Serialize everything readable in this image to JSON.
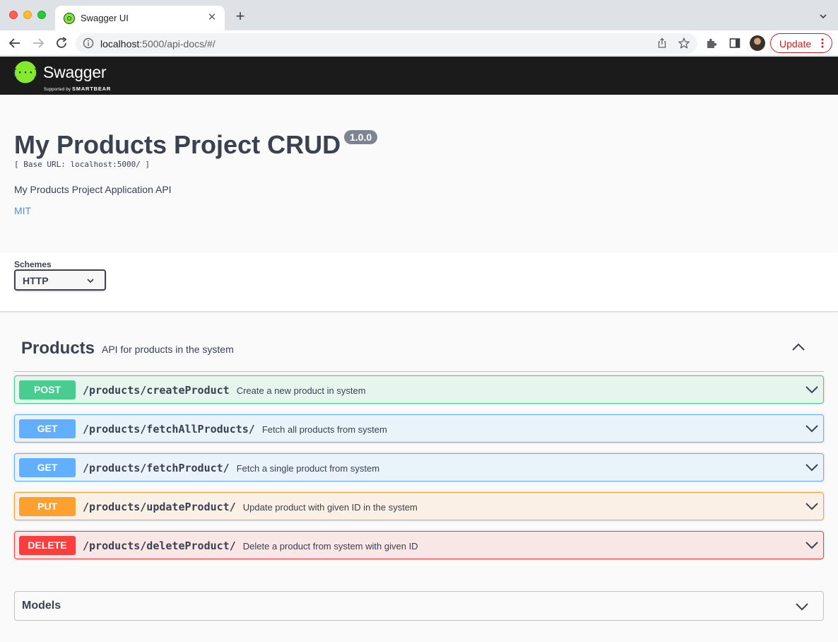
{
  "browser": {
    "tab_title": "Swagger UI",
    "url_host": "localhost",
    "url_path": ":5000/api-docs/#/",
    "update_label": "Update"
  },
  "swagger": {
    "logo_text": "Swagger",
    "logo_sub_prefix": "Supported by",
    "logo_sub_brand": "SMARTBEAR"
  },
  "info": {
    "title": "My Products Project CRUD",
    "version": "1.0.0",
    "base_url": "[ Base URL: localhost:5000/ ]",
    "description": "My Products Project Application API",
    "license": "MIT"
  },
  "schemes": {
    "label": "Schemes",
    "selected": "HTTP"
  },
  "tag": {
    "name": "Products",
    "description": "API for products in the system"
  },
  "operations": [
    {
      "method": "POST",
      "path": "/products/createProduct",
      "summary": "Create a new product in system"
    },
    {
      "method": "GET",
      "path": "/products/fetchAllProducts/",
      "summary": "Fetch all products from system"
    },
    {
      "method": "GET",
      "path": "/products/fetchProduct/",
      "summary": "Fetch a single product from system"
    },
    {
      "method": "PUT",
      "path": "/products/updateProduct/",
      "summary": "Update product with given ID in the system"
    },
    {
      "method": "DELETE",
      "path": "/products/deleteProduct/",
      "summary": "Delete a product from system with given ID"
    }
  ],
  "models": {
    "label": "Models"
  },
  "colors": {
    "post": "#49cc90",
    "get": "#61affe",
    "put": "#fca130",
    "delete": "#f93e3e",
    "swagger_green": "#85ea2d",
    "text": "#3b4151",
    "link": "#4990e2"
  },
  "icons": {
    "back": "arrow-left-icon",
    "forward": "arrow-right-icon",
    "reload": "reload-icon",
    "info": "info-icon",
    "share": "share-icon",
    "bookmark": "star-icon",
    "extensions": "puzzle-icon",
    "side_panel": "side-panel-icon",
    "menu": "kebab-icon",
    "expand": "chevron-down-icon",
    "collapse": "chevron-up-icon"
  }
}
